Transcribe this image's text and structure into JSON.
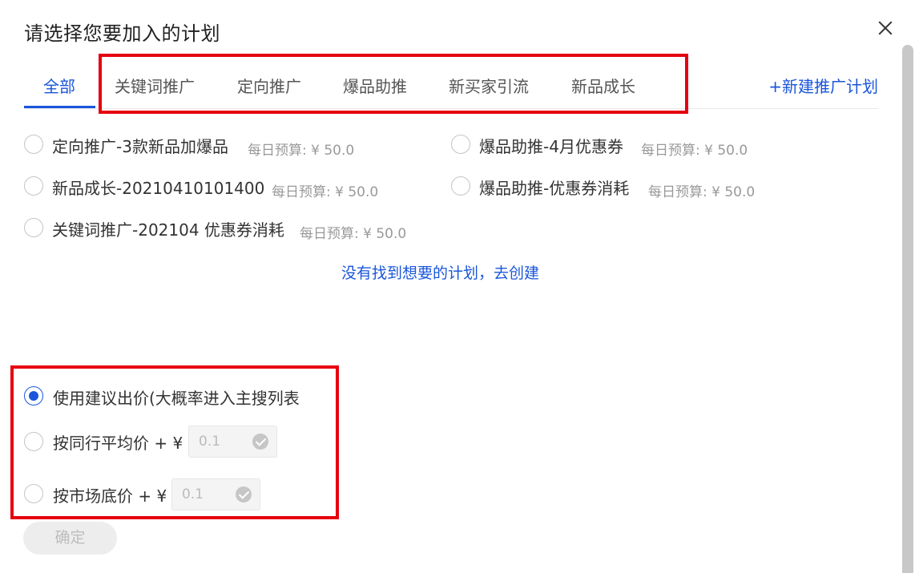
{
  "dialog": {
    "title": "请选择您要加入的计划",
    "close_icon": "close-icon"
  },
  "tabs": {
    "items": [
      {
        "label": "全部",
        "active": true
      },
      {
        "label": "关键词推广",
        "active": false
      },
      {
        "label": "定向推广",
        "active": false
      },
      {
        "label": "爆品助推",
        "active": false
      },
      {
        "label": "新买家引流",
        "active": false
      },
      {
        "label": "新品成长",
        "active": false
      }
    ],
    "new_plan_label": "+新建推广计划"
  },
  "plans": [
    {
      "name": "定向推广-3款新品加爆品",
      "budget": "每日预算: ¥ 50.0"
    },
    {
      "name": "爆品助推-4月优惠券",
      "budget": "每日预算: ¥ 50.0"
    },
    {
      "name": "新品成长-20210410101400",
      "budget": "每日预算: ¥ 50.0"
    },
    {
      "name": "爆品助推-优惠券消耗",
      "budget": "每日预算: ¥ 50.0"
    },
    {
      "name": "关键词推广-202104 优惠券消耗",
      "budget": "每日预算: ¥ 50.0"
    }
  ],
  "create_link": "没有找到想要的计划，去创建",
  "bid_options": [
    {
      "label": "使用建议出价(大概率进入主搜列表",
      "checked": true
    },
    {
      "label": "按同行平均价 + ¥",
      "checked": false,
      "input_placeholder": "0.1"
    },
    {
      "label": "按市场底价 + ¥",
      "checked": false,
      "input_placeholder": "0.1"
    }
  ],
  "confirm_label": "确定",
  "colors": {
    "accent": "#1a56db",
    "highlight_box": "#e5000f",
    "muted_text": "#999999"
  }
}
